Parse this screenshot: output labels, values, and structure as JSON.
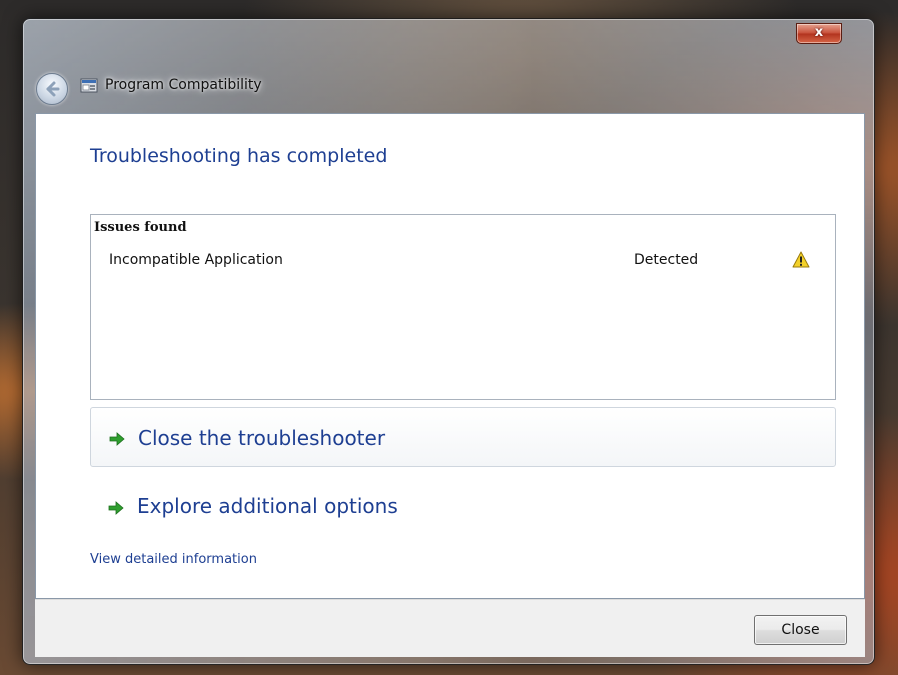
{
  "window": {
    "title": "Program Compatibility",
    "close_glyph": "x",
    "back_icon": "back-arrow-icon",
    "app_icon": "program-compatibility-icon"
  },
  "main": {
    "heading": "Troubleshooting has completed",
    "issues": {
      "header": "Issues found",
      "rows": [
        {
          "name": "Incompatible Application",
          "status": "Detected",
          "icon": "warning-icon"
        }
      ]
    },
    "options": [
      {
        "label": "Close the troubleshooter",
        "icon": "green-arrow-icon"
      },
      {
        "label": "Explore additional options",
        "icon": "green-arrow-icon"
      }
    ],
    "details_link": "View detailed information"
  },
  "footer": {
    "close_label": "Close"
  },
  "colors": {
    "heading": "#1e3f92",
    "link": "#1e3f92",
    "arrow": "#2e9e2e",
    "warning": "#f3d12a"
  }
}
